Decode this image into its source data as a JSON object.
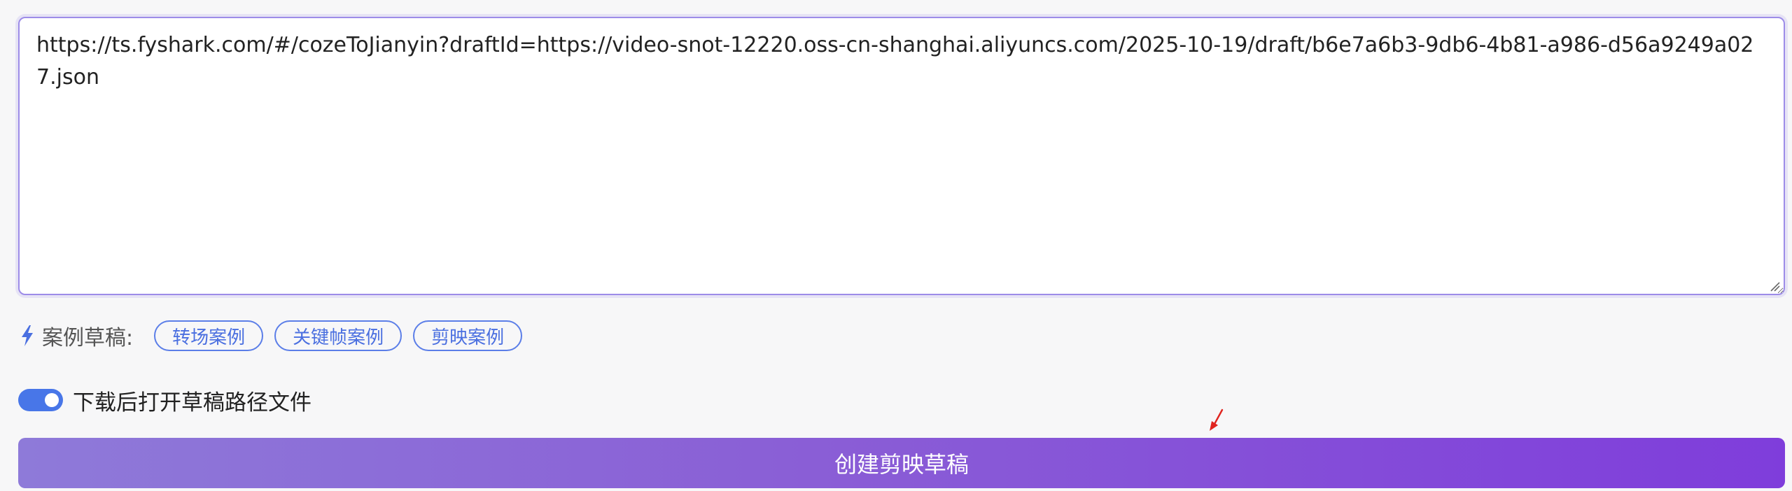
{
  "url_input": {
    "value": "https://ts.fyshark.com/#/cozeToJianyin?draftId=https://video-snot-12220.oss-cn-shanghai.aliyuncs.com/2025-10-19/draft/b6e7a6b3-9db6-4b81-a986-d56a9249a027.json"
  },
  "examples": {
    "icon": "bolt-icon",
    "label": "案例草稿:",
    "items": [
      {
        "label": "转场案例"
      },
      {
        "label": "关键帧案例"
      },
      {
        "label": "剪映案例"
      }
    ]
  },
  "option": {
    "toggle_on": true,
    "label": "下载后打开草稿路径文件"
  },
  "create_button": {
    "label": "创建剪映草稿"
  },
  "colors": {
    "accent_blue": "#4876e8",
    "chip_border": "#5b7ee8",
    "button_gradient_start": "#8e7ad9",
    "button_gradient_end": "#7f3ddb",
    "input_border": "#9d8ce8",
    "cursor_red": "#e0241f"
  }
}
